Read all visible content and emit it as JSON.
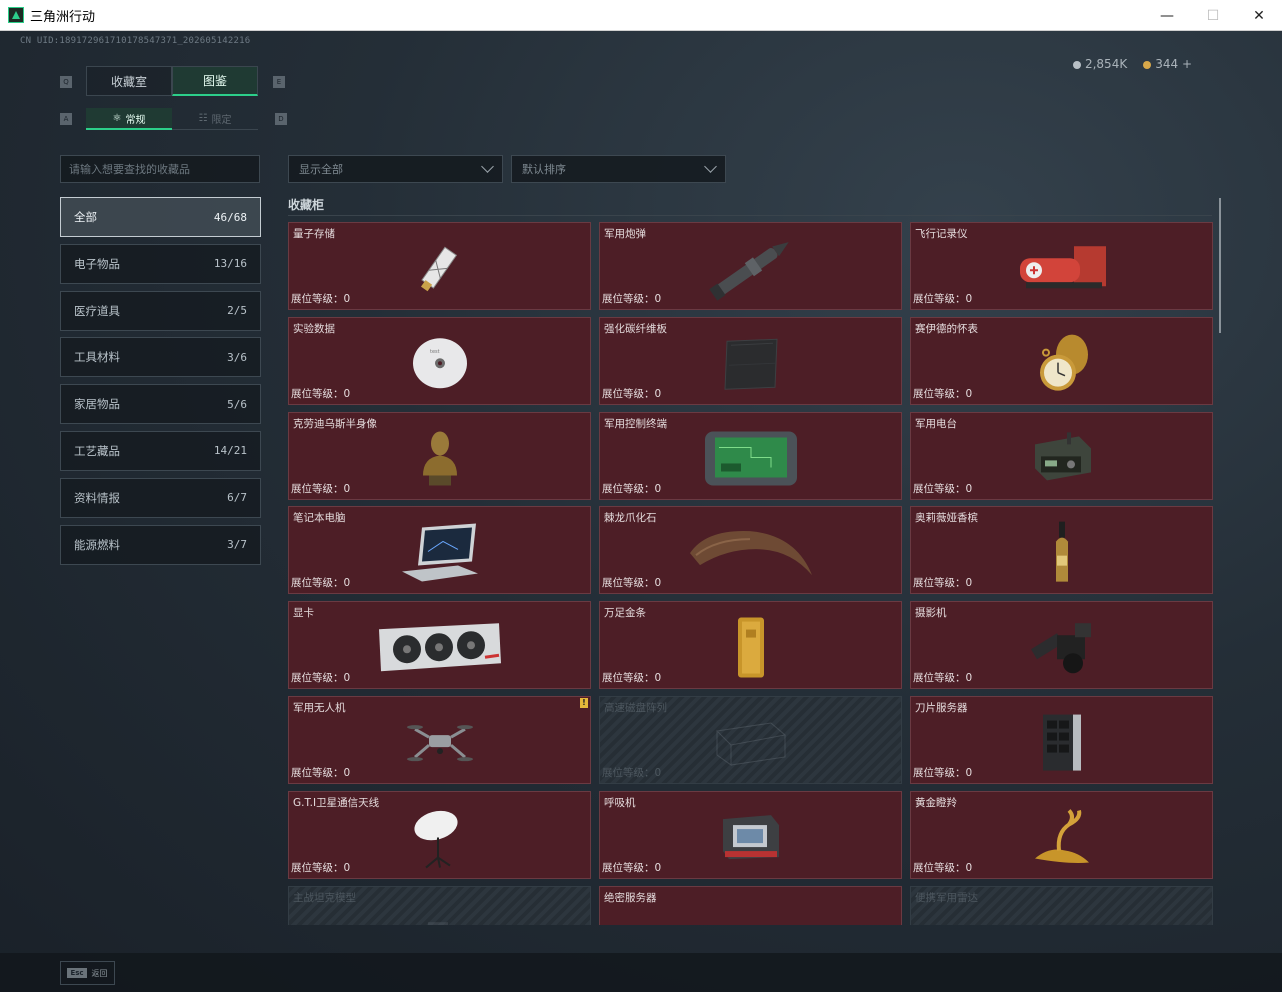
{
  "window": {
    "title": "三角洲行动"
  },
  "uid": "CN UID:189172961710178547371_202605142216",
  "currency": {
    "silver": "2,854K",
    "gold": "344",
    "add": "+"
  },
  "tabs": [
    {
      "label": "收藏室",
      "active": false
    },
    {
      "label": "图鉴",
      "active": true
    }
  ],
  "tab_keys": {
    "left": "Q",
    "right": "E"
  },
  "subtab_keys": {
    "left": "A",
    "right": "D"
  },
  "subtabs": [
    {
      "label": "常规",
      "active": true
    },
    {
      "label": "限定",
      "active": false
    }
  ],
  "search": {
    "placeholder": "请输入想要查找的收藏品"
  },
  "filters": {
    "show": "显示全部",
    "sort": "默认排序"
  },
  "categories": [
    {
      "label": "全部",
      "count": "46/68",
      "active": true
    },
    {
      "label": "电子物品",
      "count": "13/16"
    },
    {
      "label": "医疗道具",
      "count": "2/5"
    },
    {
      "label": "工具材料",
      "count": "3/6"
    },
    {
      "label": "家居物品",
      "count": "5/6"
    },
    {
      "label": "工艺藏品",
      "count": "14/21"
    },
    {
      "label": "资料情报",
      "count": "6/7"
    },
    {
      "label": "能源燃料",
      "count": "3/7"
    }
  ],
  "section": {
    "title": "收藏柜"
  },
  "items": [
    {
      "name": "量子存储",
      "level": "展位等级：0",
      "icon": "usb-drive-icon",
      "locked": false
    },
    {
      "name": "军用炮弹",
      "level": "展位等级：0",
      "icon": "artillery-shell-icon",
      "locked": false
    },
    {
      "name": "飞行记录仪",
      "level": "展位等级：0",
      "icon": "flight-recorder-icon",
      "locked": false
    },
    {
      "name": "实验数据",
      "level": "展位等级：0",
      "icon": "disc-icon",
      "locked": false
    },
    {
      "name": "强化碳纤维板",
      "level": "展位等级：0",
      "icon": "carbon-plate-icon",
      "locked": false
    },
    {
      "name": "赛伊德的怀表",
      "level": "展位等级：0",
      "icon": "pocket-watch-icon",
      "locked": false
    },
    {
      "name": "克劳迪乌斯半身像",
      "level": "展位等级：0",
      "icon": "bust-icon",
      "locked": false
    },
    {
      "name": "军用控制终端",
      "level": "展位等级：0",
      "icon": "control-terminal-icon",
      "locked": false
    },
    {
      "name": "军用电台",
      "level": "展位等级：0",
      "icon": "radio-icon",
      "locked": false
    },
    {
      "name": "笔记本电脑",
      "level": "展位等级：0",
      "icon": "laptop-icon",
      "locked": false
    },
    {
      "name": "棘龙爪化石",
      "level": "展位等级：0",
      "icon": "claw-fossil-icon",
      "locked": false
    },
    {
      "name": "奥莉薇娅香槟",
      "level": "展位等级：0",
      "icon": "champagne-icon",
      "locked": false
    },
    {
      "name": "显卡",
      "level": "展位等级：0",
      "icon": "graphics-card-icon",
      "locked": false
    },
    {
      "name": "万足金条",
      "level": "展位等级：0",
      "icon": "gold-bar-icon",
      "locked": false
    },
    {
      "name": "摄影机",
      "level": "展位等级：0",
      "icon": "camera-icon",
      "locked": false
    },
    {
      "name": "军用无人机",
      "level": "展位等级：0",
      "icon": "drone-icon",
      "locked": false,
      "badge": "!"
    },
    {
      "name": "高速磁盘阵列",
      "level": "展位等级：0",
      "icon": "disk-array-icon",
      "locked": true
    },
    {
      "name": "刀片服务器",
      "level": "展位等级：0",
      "icon": "blade-server-icon",
      "locked": false
    },
    {
      "name": "G.T.I卫星通信天线",
      "level": "展位等级：0",
      "icon": "satellite-dish-icon",
      "locked": false
    },
    {
      "name": "呼吸机",
      "level": "展位等级：0",
      "icon": "ventilator-icon",
      "locked": false
    },
    {
      "name": "黄金瞪羚",
      "level": "展位等级：0",
      "icon": "golden-gazelle-icon",
      "locked": false
    },
    {
      "name": "主战坦克模型",
      "level": "",
      "icon": "tank-model-icon",
      "locked": true
    },
    {
      "name": "绝密服务器",
      "level": "",
      "icon": "secret-server-icon",
      "locked": false
    },
    {
      "name": "便携军用雷达",
      "level": "",
      "icon": "radar-icon",
      "locked": true
    }
  ],
  "footer": {
    "esc_key": "Esc",
    "back": "返回"
  }
}
